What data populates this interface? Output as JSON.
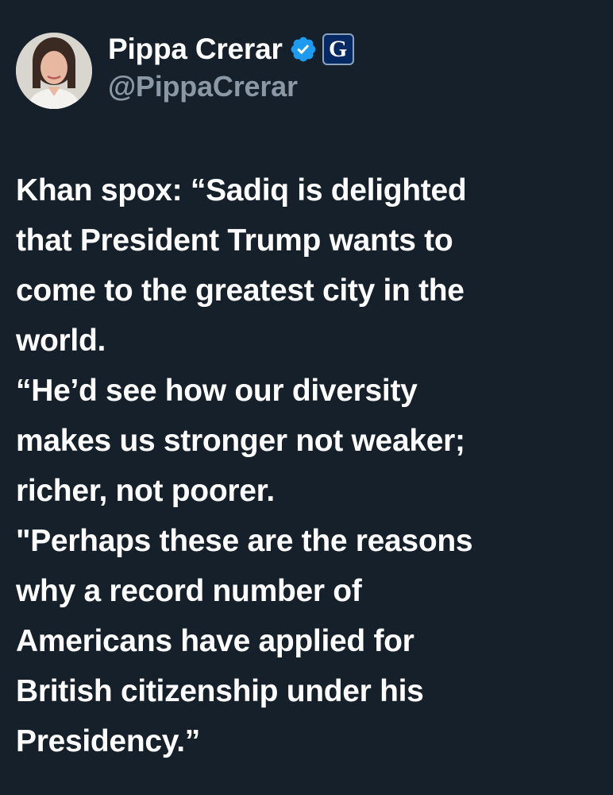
{
  "author": {
    "display_name": "Pippa Crerar",
    "handle": "@PippaCrerar",
    "verified_icon": "verified-badge-icon",
    "affiliation_badge": "G",
    "affiliation_badge_color": "#052962",
    "verified_color": "#1d9bf0"
  },
  "tweet": {
    "lines": [
      "Khan spox: “Sadiq is delighted",
      "that President Trump wants to",
      "come to the greatest city in the",
      "world.",
      "“He’d see how our diversity",
      "makes us stronger not weaker;",
      "richer, not poorer.",
      "\"Perhaps these are the reasons",
      "why a record number of",
      "Americans have applied for",
      "British citizenship under his",
      "Presidency.”"
    ]
  },
  "theme": {
    "background": "#15202b",
    "text": "#ffffff",
    "secondary_text": "#8b98a5"
  }
}
